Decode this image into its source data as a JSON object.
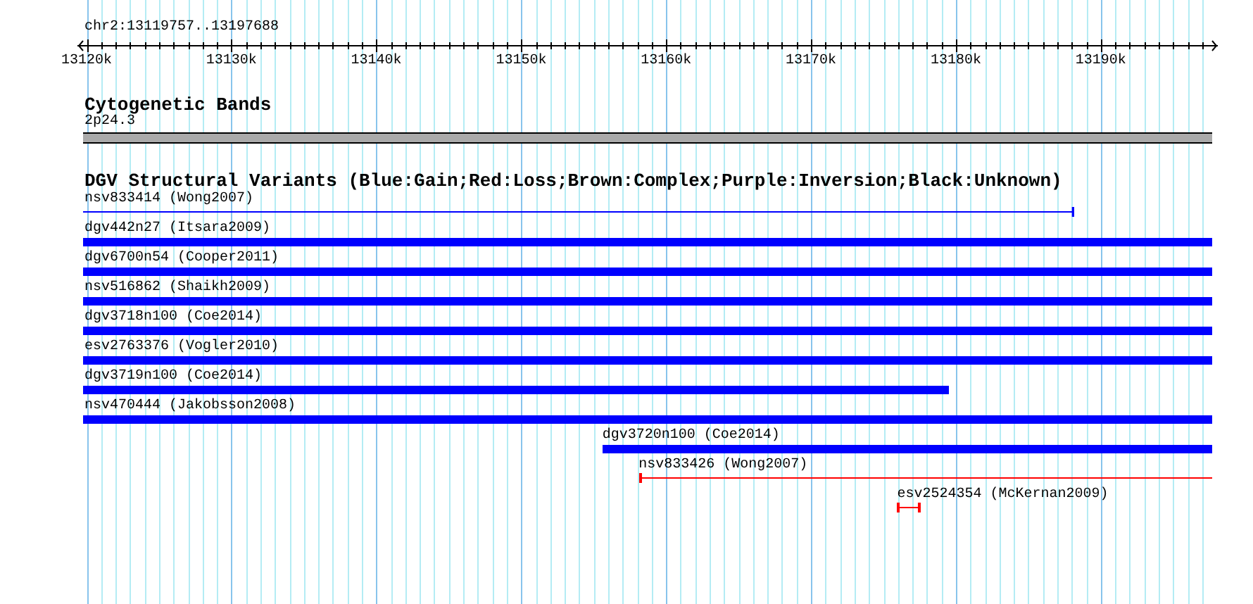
{
  "ruler": {
    "location": "chr2:13119757..13197688",
    "ticks": [
      {
        "label": "13120k"
      },
      {
        "label": "13130k"
      },
      {
        "label": "13140k"
      },
      {
        "label": "13150k"
      },
      {
        "label": "13160k"
      },
      {
        "label": "13170k"
      },
      {
        "label": "13180k"
      },
      {
        "label": "13190k"
      }
    ]
  },
  "cytogenetic_bands": {
    "title": "Cytogenetic Bands",
    "band": {
      "label": "2p24.3",
      "color": "#aaaaaa"
    }
  },
  "dgv_track": {
    "title": "DGV Structural Variants (Blue:Gain;Red:Loss;Brown:Complex;Purple:Inversion;Black:Unknown)",
    "features": [
      {
        "label": "nsv833414 (Wong2007)",
        "kind": "line",
        "color": "#0000ff"
      },
      {
        "label": "dgv442n27 (Itsara2009)",
        "kind": "bar",
        "color": "#0000ff"
      },
      {
        "label": "dgv6700n54 (Cooper2011)",
        "kind": "bar",
        "color": "#0000ff"
      },
      {
        "label": "nsv516862 (Shaikh2009)",
        "kind": "bar",
        "color": "#0000ff"
      },
      {
        "label": "dgv3718n100 (Coe2014)",
        "kind": "bar",
        "color": "#0000ff"
      },
      {
        "label": "esv2763376 (Vogler2010)",
        "kind": "bar",
        "color": "#0000ff"
      },
      {
        "label": "dgv3719n100 (Coe2014)",
        "kind": "bar",
        "color": "#0000ff"
      },
      {
        "label": "nsv470444 (Jakobsson2008)",
        "kind": "bar",
        "color": "#0000ff"
      },
      {
        "label": "dgv3720n100 (Coe2014)",
        "kind": "bar",
        "color": "#0000ff"
      },
      {
        "label": "nsv833426 (Wong2007)",
        "kind": "line",
        "color": "#ff0000"
      },
      {
        "label": "esv2524354 (McKernan2009)",
        "kind": "line",
        "color": "#ff0000"
      }
    ]
  }
}
